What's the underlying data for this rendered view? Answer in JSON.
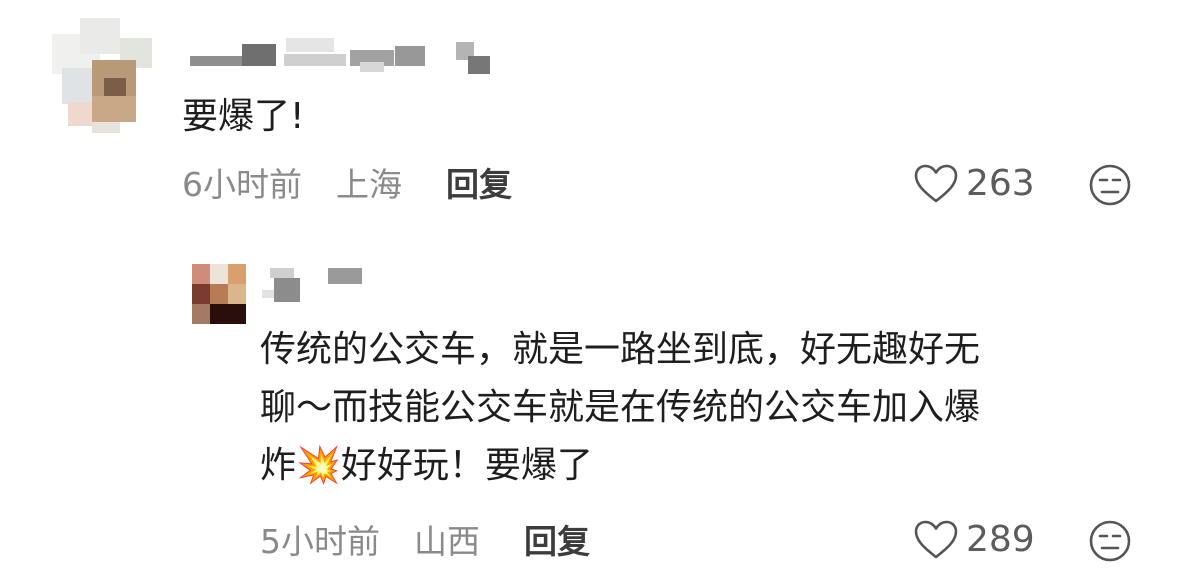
{
  "comments": [
    {
      "text": "要爆了!",
      "time": "6小时前",
      "location": "上海",
      "reply_label": "回复",
      "likes": "263"
    },
    {
      "text_lines": [
        "传统的公交车，就是一路坐到底，好无趣好无",
        "聊～而技能公交车就是在传统的公交车加入爆",
        "炸"
      ],
      "text_tail": "好好玩！要爆了",
      "emoji": "💥",
      "time": "5小时前",
      "location": "山西",
      "reply_label": "回复",
      "likes": "289"
    }
  ],
  "icons": {
    "like": "heart-outline-icon",
    "dislike": "meh-face-icon"
  },
  "colors": {
    "text": "#1e1e1e",
    "meta": "#8a8a8a",
    "icon": "#555555"
  }
}
